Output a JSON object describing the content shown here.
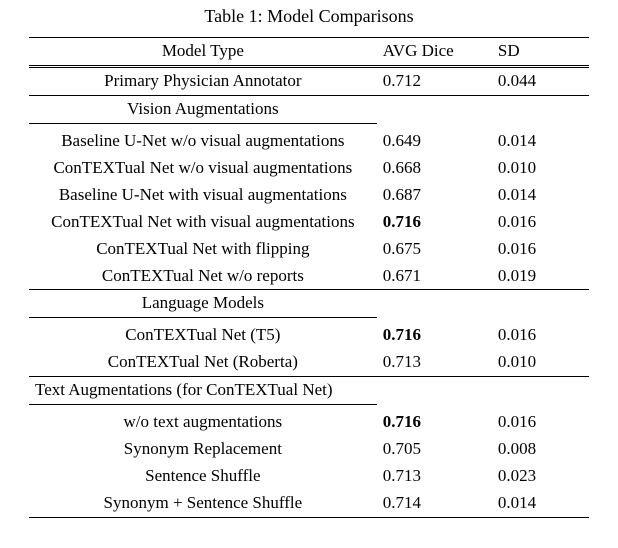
{
  "caption": "Table 1: Model Comparisons",
  "headers": {
    "model": "Model Type",
    "dice": "AVG Dice",
    "sd": "SD"
  },
  "annotator": {
    "label": "Primary Physician Annotator",
    "dice": "0.712",
    "sd": "0.044"
  },
  "sections": {
    "vision": {
      "title": "Vision Augmentations",
      "rows": [
        {
          "label": "Baseline U-Net w/o visual augmentations",
          "dice": "0.649",
          "sd": "0.014",
          "bold": false
        },
        {
          "label": "ConTEXTual Net w/o visual augmentations",
          "dice": "0.668",
          "sd": "0.010",
          "bold": false
        },
        {
          "label": "Baseline U-Net with visual augmentations",
          "dice": "0.687",
          "sd": "0.014",
          "bold": false
        },
        {
          "label": "ConTEXTual Net with visual augmentations",
          "dice": "0.716",
          "sd": "0.016",
          "bold": true
        },
        {
          "label": "ConTEXTual Net with flipping",
          "dice": "0.675",
          "sd": "0.016",
          "bold": false
        },
        {
          "label": "ConTEXTual Net w/o reports",
          "dice": "0.671",
          "sd": "0.019",
          "bold": false
        }
      ]
    },
    "language": {
      "title": "Language Models",
      "rows": [
        {
          "label": "ConTEXTual Net (T5)",
          "dice": "0.716",
          "sd": "0.016",
          "bold": true
        },
        {
          "label": "ConTEXTual Net (Roberta)",
          "dice": "0.713",
          "sd": "0.010",
          "bold": false
        }
      ]
    },
    "text": {
      "title": "Text Augmentations (for ConTEXTual Net)",
      "rows": [
        {
          "label": "w/o text augmentations",
          "dice": "0.716",
          "sd": "0.016",
          "bold": true
        },
        {
          "label": "Synonym Replacement",
          "dice": "0.705",
          "sd": "0.008",
          "bold": false
        },
        {
          "label": "Sentence Shuffle",
          "dice": "0.713",
          "sd": "0.023",
          "bold": false
        },
        {
          "label": "Synonym + Sentence Shuffle",
          "dice": "0.714",
          "sd": "0.014",
          "bold": false
        }
      ]
    }
  },
  "chart_data": {
    "type": "table",
    "title": "Table 1: Model Comparisons",
    "columns": [
      "Model Type",
      "AVG Dice",
      "SD"
    ],
    "rows": [
      [
        "Primary Physician Annotator",
        0.712,
        0.044
      ],
      [
        "Baseline U-Net w/o visual augmentations",
        0.649,
        0.014
      ],
      [
        "ConTEXTual Net w/o visual augmentations",
        0.668,
        0.01
      ],
      [
        "Baseline U-Net with visual augmentations",
        0.687,
        0.014
      ],
      [
        "ConTEXTual Net with visual augmentations",
        0.716,
        0.016
      ],
      [
        "ConTEXTual Net with flipping",
        0.675,
        0.016
      ],
      [
        "ConTEXTual Net w/o reports",
        0.671,
        0.019
      ],
      [
        "ConTEXTual Net (T5)",
        0.716,
        0.016
      ],
      [
        "ConTEXTual Net (Roberta)",
        0.713,
        0.01
      ],
      [
        "w/o text augmentations",
        0.716,
        0.016
      ],
      [
        "Synonym Replacement",
        0.705,
        0.008
      ],
      [
        "Sentence Shuffle",
        0.713,
        0.023
      ],
      [
        "Synonym + Sentence Shuffle",
        0.714,
        0.014
      ]
    ],
    "sections": {
      "Vision Augmentations": [
        "Baseline U-Net w/o visual augmentations",
        "ConTEXTual Net w/o visual augmentations",
        "Baseline U-Net with visual augmentations",
        "ConTEXTual Net with visual augmentations",
        "ConTEXTual Net with flipping",
        "ConTEXTual Net w/o reports"
      ],
      "Language Models": [
        "ConTEXTual Net (T5)",
        "ConTEXTual Net (Roberta)"
      ],
      "Text Augmentations (for ConTEXTual Net)": [
        "w/o text augmentations",
        "Synonym Replacement",
        "Sentence Shuffle",
        "Synonym + Sentence Shuffle"
      ]
    }
  }
}
